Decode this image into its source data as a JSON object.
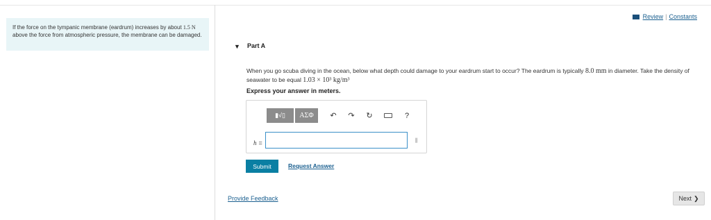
{
  "hint": {
    "text_parts": [
      "If the force on the tympanic membrane (eardrum) increases by about",
      "1.5 N",
      "above the force from atmospheric pressure, the membrane can be damaged."
    ]
  },
  "header": {
    "review_label": "Review",
    "separator": "|",
    "constants_label": "Constants"
  },
  "part": {
    "toggle_icon": "▼",
    "title": "Part A"
  },
  "question": {
    "text_before": "When you go scuba diving in the ocean, below what depth could damage to your eardrum start to occur? The eardrum is typically",
    "diameter": "8.0 mm",
    "text_middle": "in diameter. Take the density of seawater to be equal",
    "density": "1.03 × 10³ kg/m³",
    "instruction": "Express your answer in meters."
  },
  "toolbar": {
    "templates_label": "▮√▯",
    "greek_label": "ΑΣΦ",
    "undo_icon": "↶",
    "redo_icon": "↷",
    "reset_icon": "↻",
    "help_label": "?"
  },
  "answer": {
    "variable": "h",
    "equals": "=",
    "value": "",
    "units_icon": "⫼"
  },
  "actions": {
    "submit_label": "Submit",
    "request_label": "Request Answer",
    "feedback_label": "Provide Feedback",
    "next_label": "Next",
    "next_icon": "❯"
  }
}
